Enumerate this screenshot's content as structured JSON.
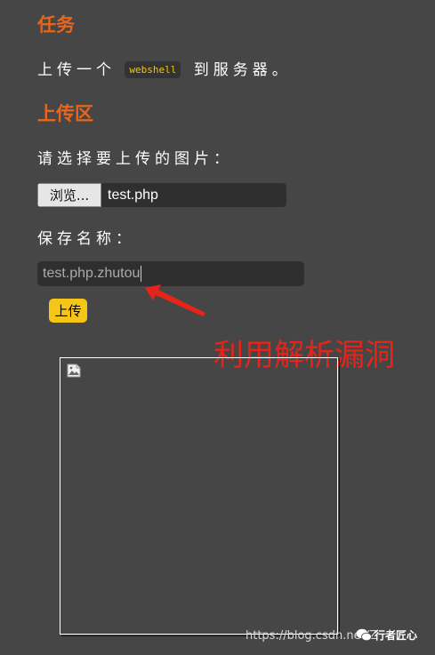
{
  "task": {
    "heading": "任务",
    "text_before": "上传一个",
    "code": "webshell",
    "text_after": "到服务器。"
  },
  "upload_area": {
    "heading": "上传区",
    "select_label": "请选择要上传的图片：",
    "browse_label": "浏览...",
    "file_name": "test.php",
    "save_label": "保存名称：",
    "save_value": "test.php.zhutou",
    "upload_label": "上传"
  },
  "annotation": {
    "text": "利用解析漏洞",
    "color": "#e8241a"
  },
  "preview": {
    "icon": "broken-image-icon"
  },
  "watermark": {
    "url": "https://blog.csdn.net/Z",
    "brand": "行者匠心",
    "icon": "wechat-icon"
  },
  "colors": {
    "background": "#464646",
    "heading": "#e8651a",
    "button": "#f5c518",
    "code": "#f0c419"
  }
}
